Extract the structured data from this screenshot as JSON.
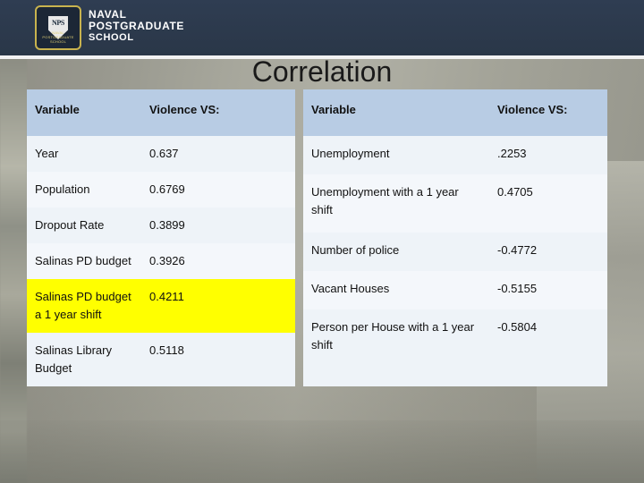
{
  "banner": {
    "seal_text": "NPS",
    "seal_band": "NAVAL POSTGRADUATE SCHOOL",
    "wordmark_line1": "NAVAL",
    "wordmark_line2": "POSTGRADUATE",
    "wordmark_line3": "SCHOOL"
  },
  "slide": {
    "title": "Correlation"
  },
  "left_table": {
    "headers": [
      "Variable",
      "Violence VS:"
    ],
    "rows": [
      {
        "variable": "Year",
        "value": "0.637",
        "style": "light"
      },
      {
        "variable": "Population",
        "value": "0.6769",
        "style": "pale"
      },
      {
        "variable": "Dropout Rate",
        "value": "0.3899",
        "style": "light"
      },
      {
        "variable": "Salinas PD budget",
        "value": "0.3926",
        "style": "pale"
      },
      {
        "variable": "Salinas PD budget a 1 year shift",
        "value": "0.4211",
        "style": "yellow"
      },
      {
        "variable": "Salinas Library Budget",
        "value": "0.5118",
        "style": "light"
      }
    ]
  },
  "right_table": {
    "headers": [
      "Variable",
      "Violence VS:"
    ],
    "rows": [
      {
        "variable": "Unemployment",
        "value": ".2253",
        "style": "light"
      },
      {
        "variable": "Unemployment with a 1 year shift",
        "value": "0.4705",
        "style": "pale"
      },
      {
        "variable": "Number of police",
        "value": "-0.4772",
        "style": "light"
      },
      {
        "variable": "Vacant Houses",
        "value": "-0.5155",
        "style": "pale"
      },
      {
        "variable": "Person per House with a 1 year shift",
        "value": "-0.5804",
        "style": "light"
      },
      {
        "variable": "",
        "value": "",
        "style": "blank"
      }
    ]
  }
}
